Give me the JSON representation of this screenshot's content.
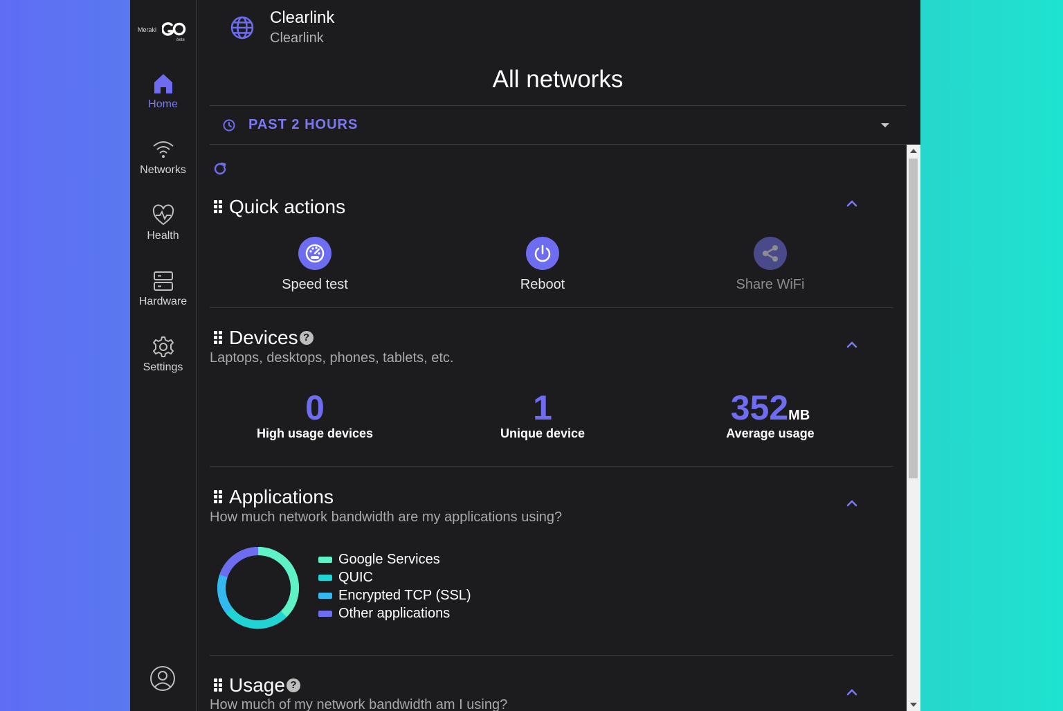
{
  "sidebar": {
    "logo": {
      "brand": "Meraki",
      "product": "GO",
      "tag": "beta"
    },
    "items": [
      {
        "label": "Home",
        "icon": "home-icon",
        "active": true
      },
      {
        "label": "Networks",
        "icon": "wifi-icon",
        "active": false
      },
      {
        "label": "Health",
        "icon": "heart-pulse-icon",
        "active": false
      },
      {
        "label": "Hardware",
        "icon": "server-icon",
        "active": false
      },
      {
        "label": "Settings",
        "icon": "gear-icon",
        "active": false
      }
    ],
    "account_icon": "user-circle-icon"
  },
  "header": {
    "org_name": "Clearlink",
    "org_sub": "Clearlink",
    "page_title": "All networks"
  },
  "time_filter": {
    "label": "PAST 2 HOURS"
  },
  "quick_actions": {
    "title": "Quick actions",
    "actions": [
      {
        "label": "Speed test",
        "icon": "speedometer-icon",
        "enabled": true
      },
      {
        "label": "Reboot",
        "icon": "power-icon",
        "enabled": true
      },
      {
        "label": "Share WiFi",
        "icon": "share-icon",
        "enabled": false
      }
    ]
  },
  "devices": {
    "title": "Devices",
    "subtitle": "Laptops, desktops, phones, tablets, etc.",
    "stats": [
      {
        "value": "0",
        "unit": "",
        "label": "High usage devices"
      },
      {
        "value": "1",
        "unit": "",
        "label": "Unique device"
      },
      {
        "value": "352",
        "unit": "MB",
        "label": "Average usage"
      }
    ]
  },
  "applications": {
    "title": "Applications",
    "subtitle": "How much network bandwidth are my applications using?",
    "legend": [
      {
        "label": "Google Services",
        "color": "#5ef2c6"
      },
      {
        "label": "QUIC",
        "color": "#22d3d3"
      },
      {
        "label": "Encrypted TCP (SSL)",
        "color": "#33b8f0"
      },
      {
        "label": "Other applications",
        "color": "#6e6cf0"
      }
    ]
  },
  "usage": {
    "title": "Usage",
    "subtitle": "How much of my network bandwidth am I using?"
  },
  "colors": {
    "accent": "#6e6cf0",
    "background": "#1c1c1e"
  }
}
